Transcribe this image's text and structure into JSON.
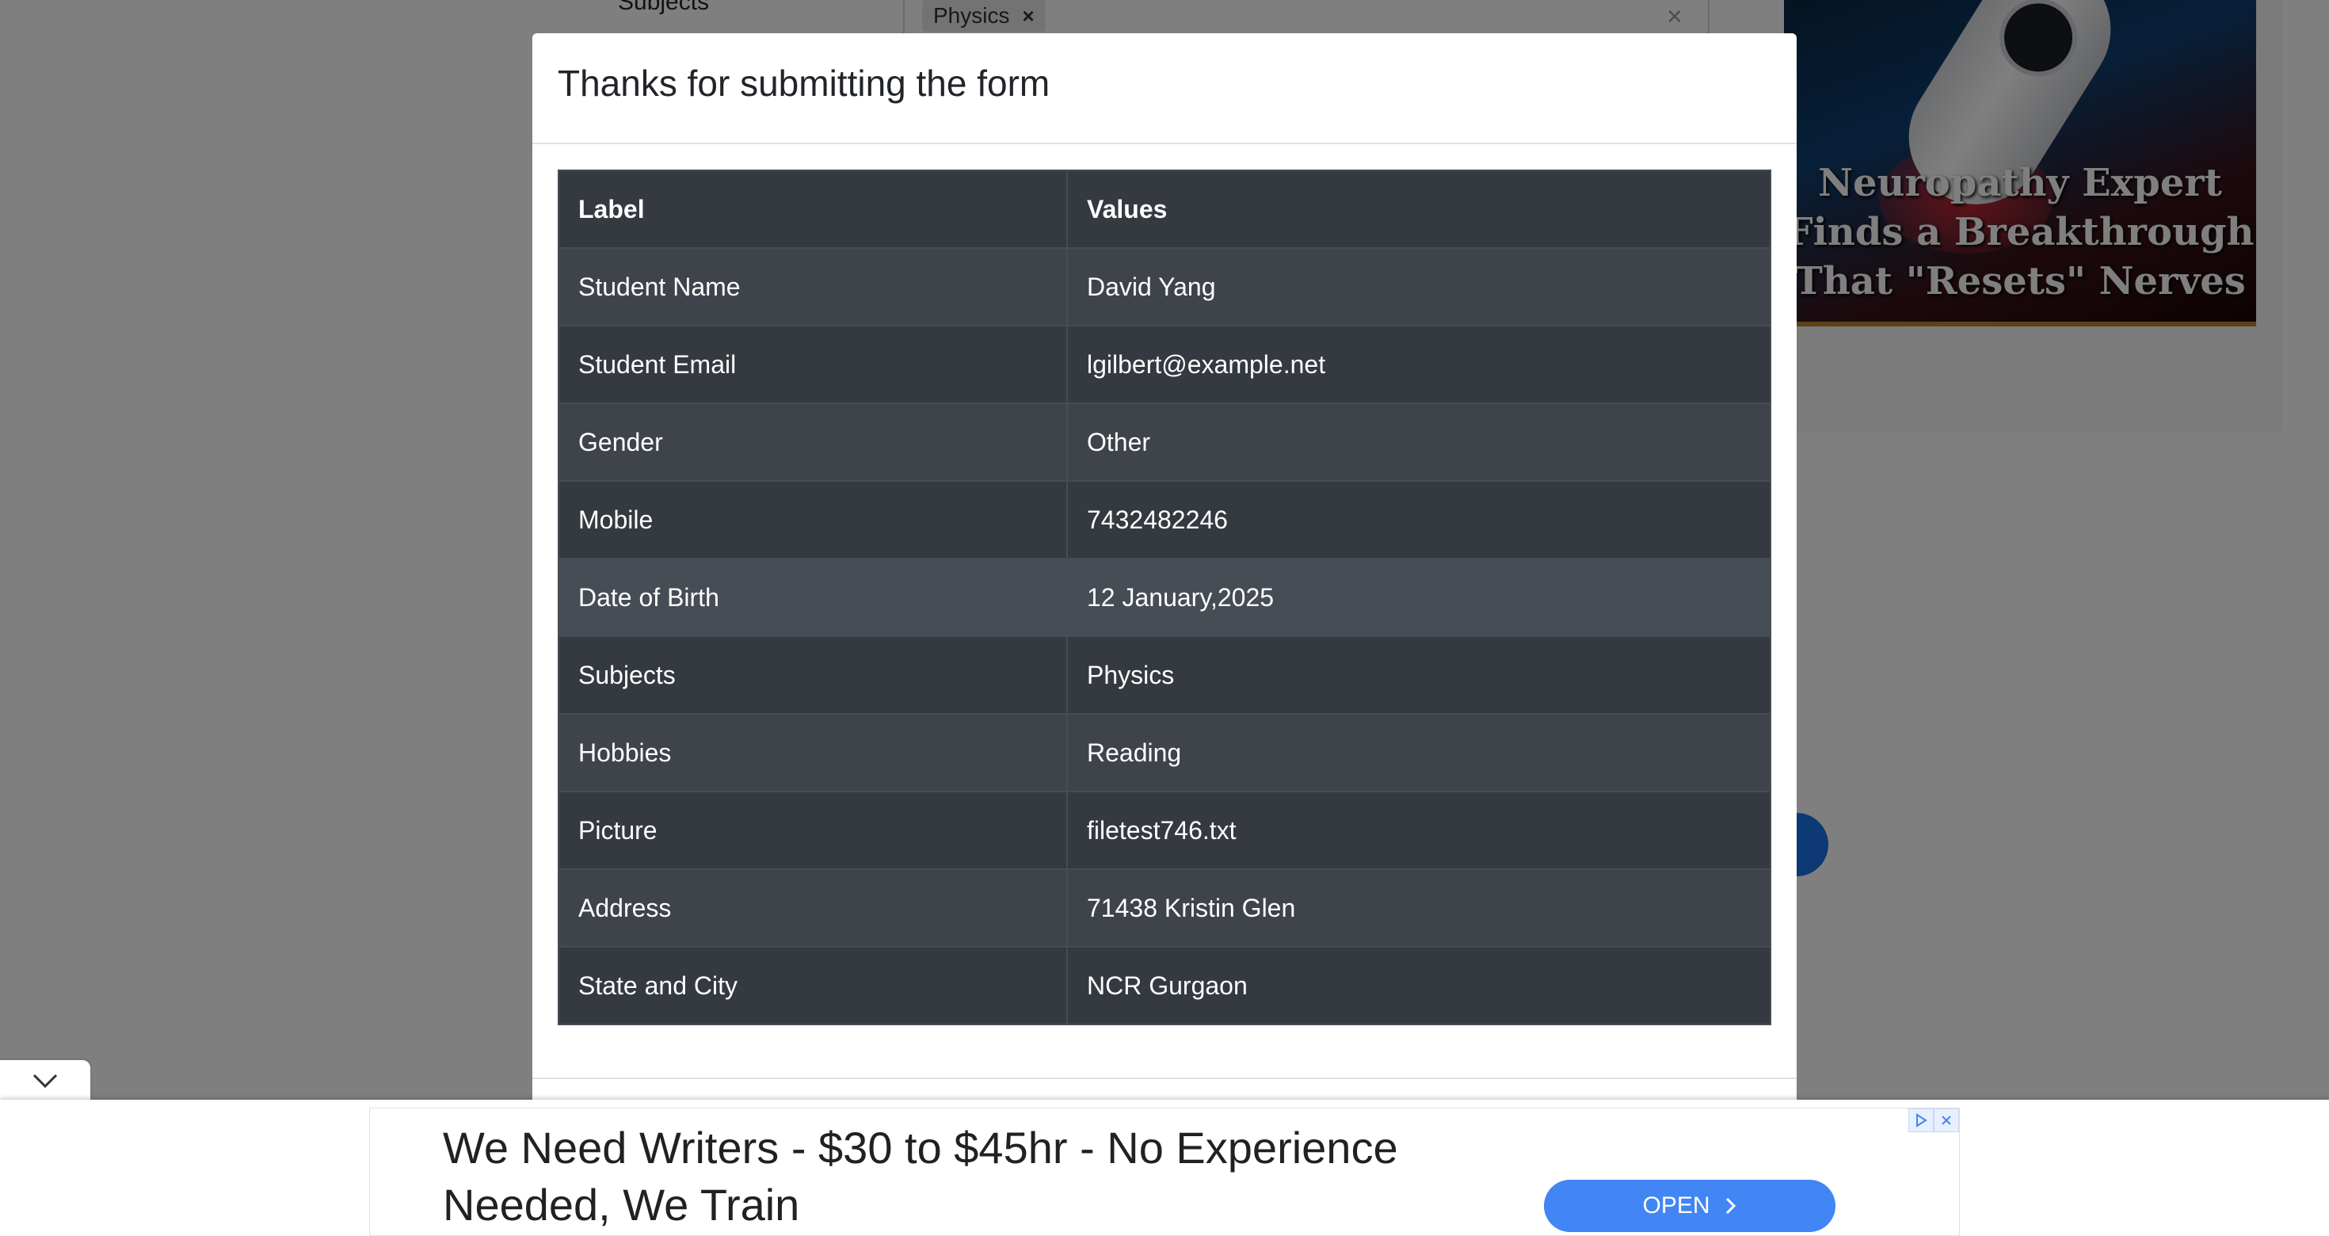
{
  "background": {
    "subjects_label": "Subjects",
    "subject_chip": "Physics"
  },
  "side_ad": {
    "headline": "Neuropathy Expert Finds a Breakthrough That \"Resets\" Nerves"
  },
  "modal": {
    "title": "Thanks for submitting the form",
    "table": {
      "headers": [
        "Label",
        "Values"
      ],
      "rows": [
        {
          "label": "Student Name",
          "value": "David Yang"
        },
        {
          "label": "Student Email",
          "value": "lgilbert@example.net"
        },
        {
          "label": "Gender",
          "value": "Other"
        },
        {
          "label": "Mobile",
          "value": "7432482246"
        },
        {
          "label": "Date of Birth",
          "value": "12 January,2025"
        },
        {
          "label": "Subjects",
          "value": "Physics"
        },
        {
          "label": "Hobbies",
          "value": "Reading"
        },
        {
          "label": "Picture",
          "value": "filetest746.txt"
        },
        {
          "label": "Address",
          "value": "71438 Kristin Glen"
        },
        {
          "label": "State and City",
          "value": "NCR Gurgaon"
        }
      ]
    }
  },
  "bottom_ad": {
    "text": "We Need Writers - $30 to $45hr - No Experience Needed, We Train",
    "button_label": "OPEN",
    "icons": [
      "adchoices-icon",
      "close-icon",
      "chevron-down-icon",
      "chevron-right-icon"
    ]
  },
  "colors": {
    "table_dark": "#343a40",
    "table_row": "#3e444a",
    "ad_button": "#4285f4"
  }
}
